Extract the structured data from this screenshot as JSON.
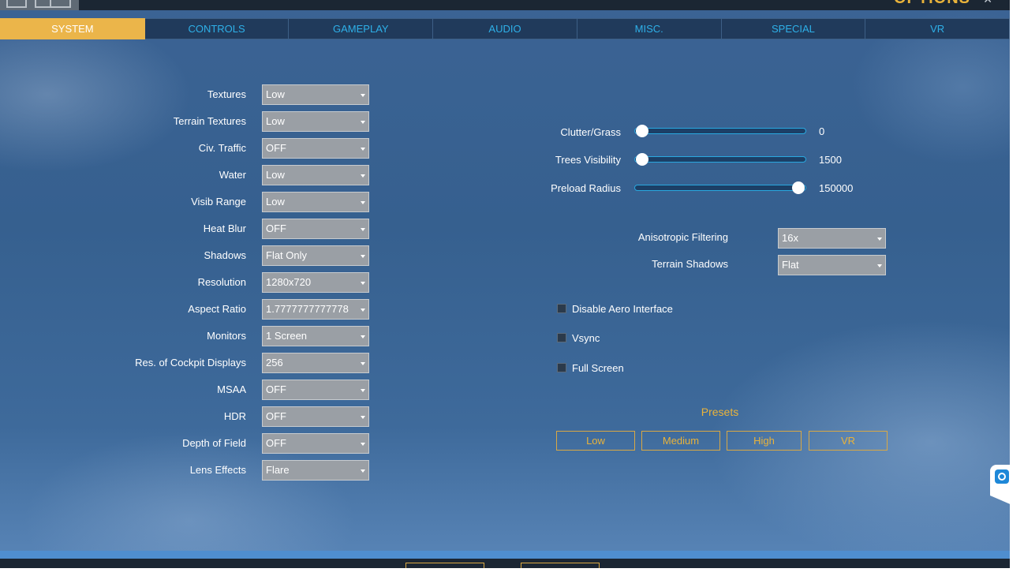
{
  "window": {
    "title": "OPTIONS",
    "close_glyph": "✕"
  },
  "tabs": [
    {
      "label": "SYSTEM",
      "active": true
    },
    {
      "label": "CONTROLS",
      "active": false
    },
    {
      "label": "GAMEPLAY",
      "active": false
    },
    {
      "label": "AUDIO",
      "active": false
    },
    {
      "label": "MISC.",
      "active": false
    },
    {
      "label": "SPECIAL",
      "active": false
    },
    {
      "label": "VR",
      "active": false
    }
  ],
  "settings": [
    {
      "label": "Textures",
      "value": "Low"
    },
    {
      "label": "Terrain Textures",
      "value": "Low"
    },
    {
      "label": "Civ. Traffic",
      "value": "OFF"
    },
    {
      "label": "Water",
      "value": "Low"
    },
    {
      "label": "Visib Range",
      "value": "Low"
    },
    {
      "label": "Heat Blur",
      "value": "OFF"
    },
    {
      "label": "Shadows",
      "value": "Flat Only"
    },
    {
      "label": "Resolution",
      "value": "1280x720"
    },
    {
      "label": "Aspect Ratio",
      "value": "1.7777777777778"
    },
    {
      "label": "Monitors",
      "value": "1 Screen"
    },
    {
      "label": "Res. of Cockpit Displays",
      "value": "256"
    },
    {
      "label": "MSAA",
      "value": "OFF"
    },
    {
      "label": "HDR",
      "value": "OFF"
    },
    {
      "label": "Depth of Field",
      "value": "OFF"
    },
    {
      "label": "Lens Effects",
      "value": "Flare"
    }
  ],
  "sliders": [
    {
      "label": "Clutter/Grass",
      "value": "0",
      "fill": 0.0
    },
    {
      "label": "Trees Visibility",
      "value": "1500",
      "fill": 0.0
    },
    {
      "label": "Preload Radius",
      "value": "150000",
      "fill": 1.0
    }
  ],
  "right_dropdowns": [
    {
      "label": "Anisotropic Filtering",
      "value": "16x"
    },
    {
      "label": "Terrain Shadows",
      "value": "Flat"
    }
  ],
  "checkboxes": [
    {
      "label": "Disable Aero Interface",
      "checked": false
    },
    {
      "label": "Vsync",
      "checked": false
    },
    {
      "label": "Full Screen",
      "checked": false
    }
  ],
  "presets": {
    "title": "Presets",
    "buttons": [
      "Low",
      "Medium",
      "High",
      "VR"
    ]
  },
  "colors": {
    "accent": "#e9b33b",
    "tab_text": "#2eb0e8",
    "active_tab": "#ebb54a",
    "background": "#3b6394"
  },
  "icons": {
    "logo": "app-logo-icon",
    "side_widget": "remote-support-icon"
  }
}
